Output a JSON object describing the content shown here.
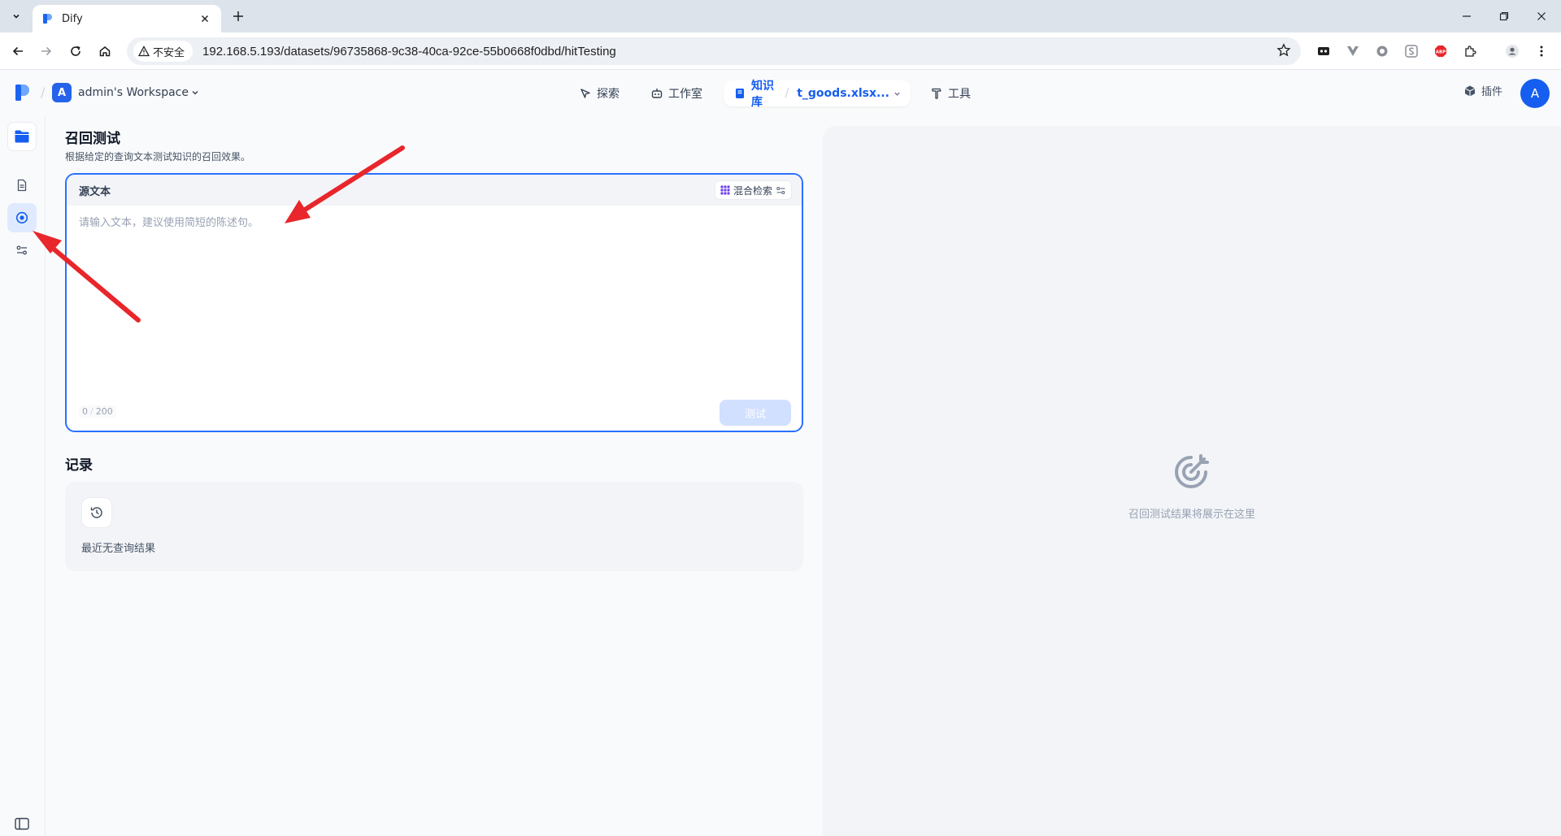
{
  "browser": {
    "tab_title": "Dify",
    "security_label": "不安全",
    "url": "192.168.5.193/datasets/96735868-9c38-40ca-92ce-55b0668f0dbd/hitTesting"
  },
  "header": {
    "workspace_initial": "A",
    "workspace_name": "admin's Workspace",
    "nav": {
      "explore": "探索",
      "studio": "工作室",
      "knowledge": "知识库",
      "dataset_name": "t_goods.xlsx...",
      "tools": "工具"
    },
    "plugins_label": "插件",
    "avatar_initial": "A"
  },
  "main": {
    "title": "召回测试",
    "subtitle": "根据给定的查询文本测试知识的召回效果。",
    "query": {
      "source_label": "源文本",
      "method_label": "混合检索",
      "placeholder": "请输入文本，建议使用简短的陈述句。",
      "char_count": "0",
      "char_limit": "200",
      "test_button": "测试"
    },
    "records": {
      "title": "记录",
      "empty_text": "最近无查询结果"
    }
  },
  "result_panel": {
    "empty_text": "召回测试结果将展示在这里"
  },
  "colors": {
    "accent": "#155eef",
    "focus_border": "#2970ff",
    "annotation_arrow": "#e8262b"
  }
}
